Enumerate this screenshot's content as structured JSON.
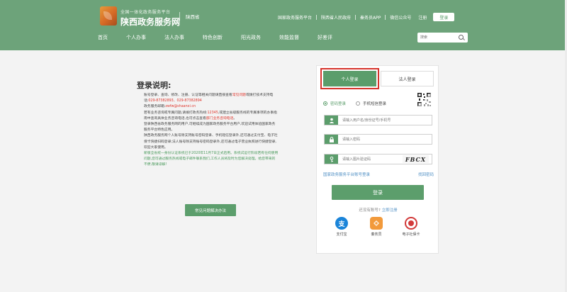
{
  "header": {
    "brand_sub": "全国一体化政务服务平台",
    "brand_title": "陕西政务服务网",
    "region": "陕西省",
    "toplinks": [
      "国家政务服务平台",
      "陕西省人民政府",
      "秦务员APP",
      "微信公众号"
    ],
    "register": "注册",
    "login": "登录",
    "search_placeholder": "搜索"
  },
  "nav": [
    "首页",
    "个人办事",
    "法人办事",
    "特色创新",
    "阳光政务",
    "效能监督",
    "好差评"
  ],
  "instructions": {
    "title": "登录说明:",
    "p1_a": "账号登录、查询、修改、注册、认证等相关问题请直接查看",
    "p1_red": "常见问题",
    "p1_b": "或拨打技术支持电话:",
    "p1_phone": "029-87382893、029-87382894",
    "p2_a": "政务服务邮箱:",
    "p2_email": "zwfw@shaanxi.cn",
    "p3_a": "若有业务咨询或专属问题,请拨打政务热线:",
    "p3_hotline": "12345",
    "p3_b": ",或建立省级服务线的专属事项的办事指南中查询具体业务咨询电话,也可点击查看",
    "p3_link": "部门业务咨询电话",
    "p3_c": "。",
    "p4": "登录陕西省政务服务网的用户,可继续成为国家政务服务平台用户,欢迎试用体验国家政务服务平台特色应用。",
    "p5": "陕西政务服务网个人账号除支持账号密码登录、手机短信登录外,还可通过支付宝、电子社保卡快捷扫码登录;法人账号除支持账号密码登录外,还可通过电子营业执照进行快捷登录,欢迎大家使用。",
    "p6": "新版全省统一身份认证系统已于2020年11月7日正式启用。系统试运行阶段若有任何使用问题,您可通过服务热线或电子邮件联系我们,工作人员将及时为您解决处理。给您带来的不便,敬请谅解!",
    "faq_button": "常见问题解决办法"
  },
  "card": {
    "tab_personal": "个人登录",
    "tab_corp": "法人登录",
    "radio_password": "密码登录",
    "radio_sms": "手机短信登录",
    "username_placeholder": "请输入用户名/身份证号/手机号",
    "password_placeholder": "请输入密码",
    "captcha_placeholder": "请输入图片验证码",
    "captcha_text": "FBCX",
    "national_login": "国家政务服务平台账号登录",
    "forgot_password": "找回密码",
    "submit": "登录",
    "no_account": "还没有账号?",
    "register_now": "立即注册",
    "alt_logins": [
      {
        "label": "支付宝",
        "icon": "alipay-icon",
        "glyph": "支"
      },
      {
        "label": "秦务员",
        "icon": "qinwuyuan-app-icon",
        "glyph": ""
      },
      {
        "label": "电子社保卡",
        "icon": "social-security-card-icon",
        "glyph": ""
      }
    ]
  },
  "colors": {
    "primary": "#5b9d6b",
    "header": "#6da37a",
    "highlight": "#d6332b",
    "link": "#4f8fc4"
  }
}
